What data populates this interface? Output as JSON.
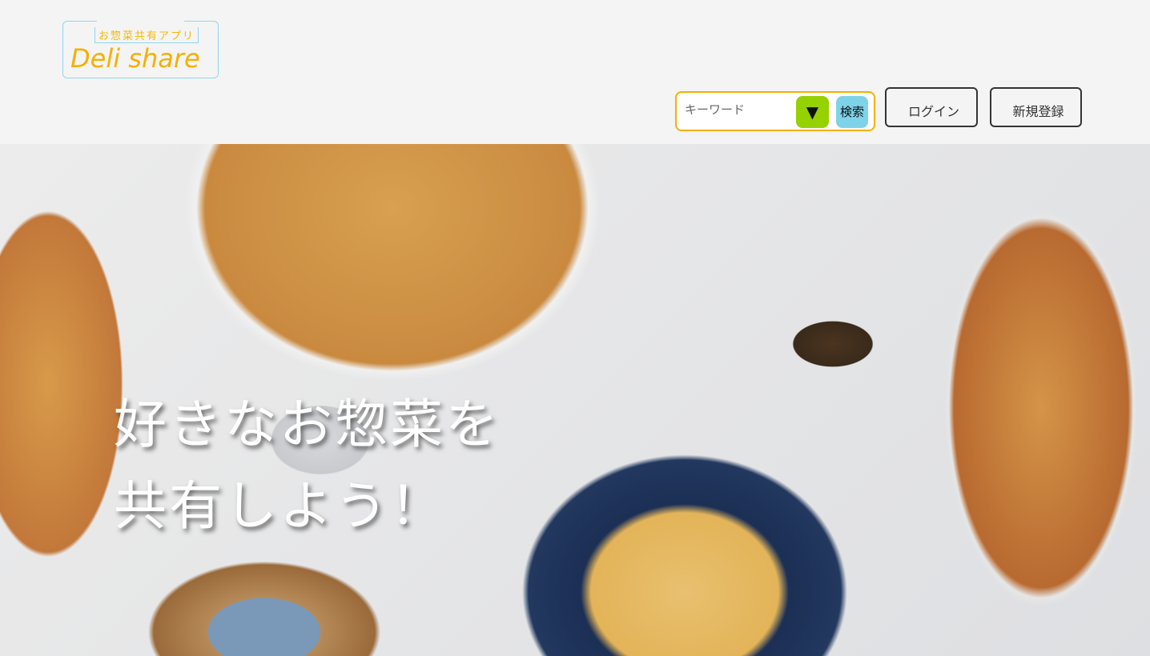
{
  "header": {
    "logo": {
      "subtitle": "お惣菜共有アプリ",
      "title": "Deli share"
    },
    "search": {
      "placeholder": "キーワード",
      "dropdown_symbol": "▼",
      "button_label": "検索"
    },
    "login_label": "ログイン",
    "signup_label": "新規登録"
  },
  "hero": {
    "line1": "好きなお惣菜を",
    "line2": "共有しよう！"
  },
  "colors": {
    "accent_orange": "#f5b000",
    "green": "#96d100",
    "blue": "#7ed3e8"
  }
}
